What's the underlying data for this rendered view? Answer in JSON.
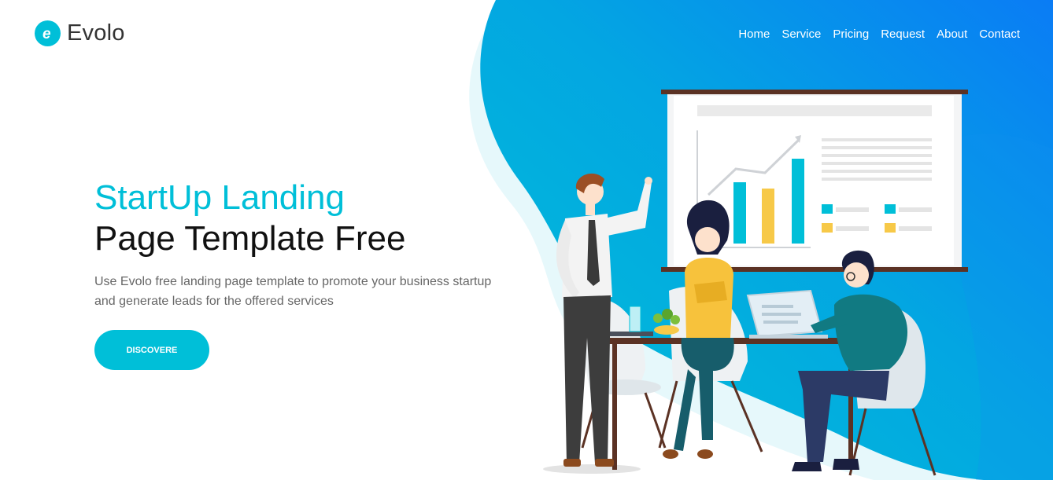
{
  "brand": {
    "name": "Evolo",
    "icon": "logo-e-icon"
  },
  "nav": {
    "items": [
      {
        "label": "Home"
      },
      {
        "label": "Service"
      },
      {
        "label": "Pricing"
      },
      {
        "label": "Request"
      },
      {
        "label": "About"
      },
      {
        "label": "Contact"
      }
    ]
  },
  "hero": {
    "title_line1": "StartUp Landing",
    "title_line2": "Page Template Free",
    "lead": "Use Evolo free landing page template to promote your business startup and generate leads for the offered services",
    "cta_label": "DISCOVERE"
  },
  "colors": {
    "accent": "#00bfd8",
    "blob_start": "#00c1d6",
    "blob_end": "#0a7cf5"
  }
}
